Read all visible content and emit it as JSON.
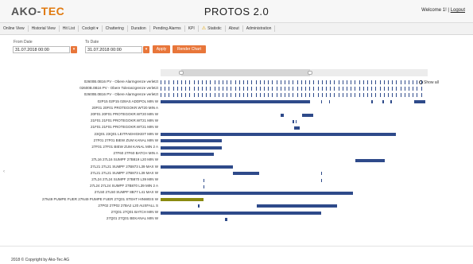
{
  "header": {
    "logo_part1": "AKO-",
    "logo_part2": "TEC",
    "title": "PROTOS 2.0",
    "welcome": "Welcome 1! |",
    "logout": "Logout"
  },
  "nav": [
    {
      "label": "Online View"
    },
    {
      "label": "Historial View"
    },
    {
      "label": "Hit List"
    },
    {
      "label": "Cockpit ▾"
    },
    {
      "label": "Chattering"
    },
    {
      "label": "Duration"
    },
    {
      "label": "Pending Alarms"
    },
    {
      "label": "KPI"
    },
    {
      "label": "Statistic",
      "warn": "⚠"
    },
    {
      "label": "About"
    },
    {
      "label": "Administration"
    }
  ],
  "filters": {
    "from_label": "From Date",
    "from_value": "31.07.2018 00:00",
    "to_label": "To Date",
    "to_value": "31.07.2018 00:00",
    "apply": "Apply",
    "render": "Render Chart"
  },
  "chart": {
    "show_all": "Show all",
    "rows": [
      {
        "label": "02600B.0B16 PV - Obere Alarmgrenze verletzt",
        "type": "ticks"
      },
      {
        "label": "02600B.0B16 PV - Obere Toleranzgrenze verletzt",
        "type": "ticks"
      },
      {
        "label": "02600B.0B16 PV - Obere Alarmgrenze verletzt",
        "type": "ticks"
      },
      {
        "label": "02P15 02P15 028AS ADDPOL MIN W",
        "type": "bars"
      },
      {
        "label": "20F01 20F01 PROTEGOKR.WT20 MIN A",
        "type": "bars"
      },
      {
        "label": "20F01 20F01 PROTEGOKR.WT20 MIN W",
        "type": "bars"
      },
      {
        "label": "21F01 21F01 PROTEGOKR.WT21 MIN W",
        "type": "bars"
      },
      {
        "label": "21F01 21F01 PROTEGOKR.WT21 MIN W",
        "type": "bars"
      },
      {
        "label": "23Q01 23Q01 LEITFAEHIGKEIT MIN W",
        "type": "bars"
      },
      {
        "label": "27F01 27F01 BIEW ZUM KANAL MIN W",
        "type": "bars"
      },
      {
        "label": "27F01 27F01 BIEW ZUM KANAL MIN 2 A",
        "type": "bars"
      },
      {
        "label": "27F60 27F60 BATCH MIN A",
        "type": "bars"
      },
      {
        "label": "27L16 27L16 SUMPF 27B819 L20 MIN W",
        "type": "bars"
      },
      {
        "label": "27L21 27L21 SUMPF 27B873 L39 MAX W",
        "type": "bars"
      },
      {
        "label": "27L21 27L21 SUMPF 27B873 L39 MAX W",
        "type": "bars"
      },
      {
        "label": "27L24 27L24 SUMPF 27B870 L39 MIN W",
        "type": "bars"
      },
      {
        "label": "27L24 27L24 SUMPF 27B870 L39 MIN 2 A",
        "type": "bars"
      },
      {
        "label": "27L50 27L50 SUMPF 8B77 L41 MAX W",
        "type": "bars"
      },
      {
        "label": "27N49 PUMPE FUER 27N49 PUMPE FUER 27Q01 STEHT HINWEIS W",
        "type": "bars"
      },
      {
        "label": "27P02 27P02 27BA2 L20 AUSFALL S",
        "type": "bars"
      },
      {
        "label": "27Q01 27Q01 BATCH MIN W",
        "type": "bars"
      },
      {
        "label": "27Q01 27Q01 BEKANAL MIN W",
        "type": "bars"
      }
    ]
  },
  "footer": {
    "copyright": "2018 © Copyright by Ako-Tec AG"
  }
}
